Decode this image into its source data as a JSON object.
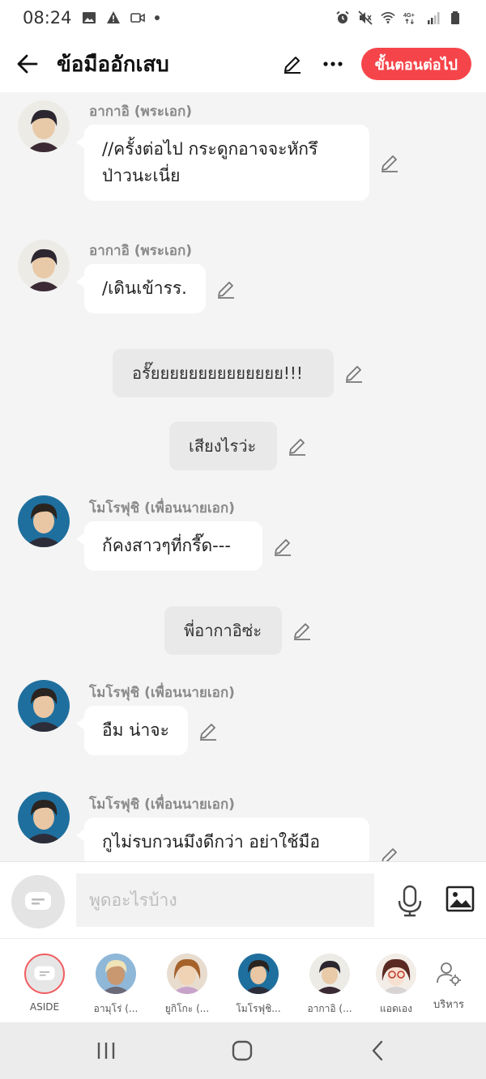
{
  "status_bar": {
    "time": "08:24"
  },
  "header": {
    "title": "ข้อมืออักเสบ",
    "next_label": "ขั้นตอนต่อไป"
  },
  "messages": [
    {
      "type": "chat",
      "speaker": "อากาอิ (พระเอก)",
      "lines": [
        "//ครั้งต่อไป กระดูกอาจจะหักรึ",
        "ป่าวนะเนี่ย"
      ]
    },
    {
      "type": "chat",
      "speaker": "อากาอิ (พระเอก)",
      "lines": [
        "/เดินเข้ารร."
      ]
    },
    {
      "type": "narration",
      "text": "อรั๊ยยยยยยยยยยยยยย!!!"
    },
    {
      "type": "narration",
      "text": "เสียงไรว่ะ"
    },
    {
      "type": "chat",
      "speaker": "โมโรฟุชิ (เพื่อนนายเอก)",
      "lines": [
        "ก้คงสาวๆที่กรี๊ด---"
      ]
    },
    {
      "type": "narration",
      "text": "พี่อากาอิซ่ะ"
    },
    {
      "type": "chat",
      "speaker": "โมโรฟุชิ (เพื่อนนายเอก)",
      "lines": [
        "อืม น่าจะ"
      ]
    },
    {
      "type": "chat",
      "speaker": "โมโรฟุชิ (เพื่อนนายเอก)",
      "lines": [
        "กูไม่รบกวนมึงดีกว่า อย่าใช้มือ"
      ]
    }
  ],
  "input": {
    "placeholder": "พูดอะไรบ้าง"
  },
  "characters": [
    {
      "label": "ASIDE"
    },
    {
      "label": "อามุโร่ (..."
    },
    {
      "label": "ยูกิโกะ (..."
    },
    {
      "label": "โมโรฟุชิ..."
    },
    {
      "label": "อากาอิ (..."
    },
    {
      "label": "แอดเอง"
    },
    {
      "label": "บริหาร"
    }
  ],
  "colors": {
    "accent": "#f5454a",
    "bubble": "#ffffff",
    "narration_bg": "#e9e9e9",
    "background": "#f4f4f4"
  }
}
